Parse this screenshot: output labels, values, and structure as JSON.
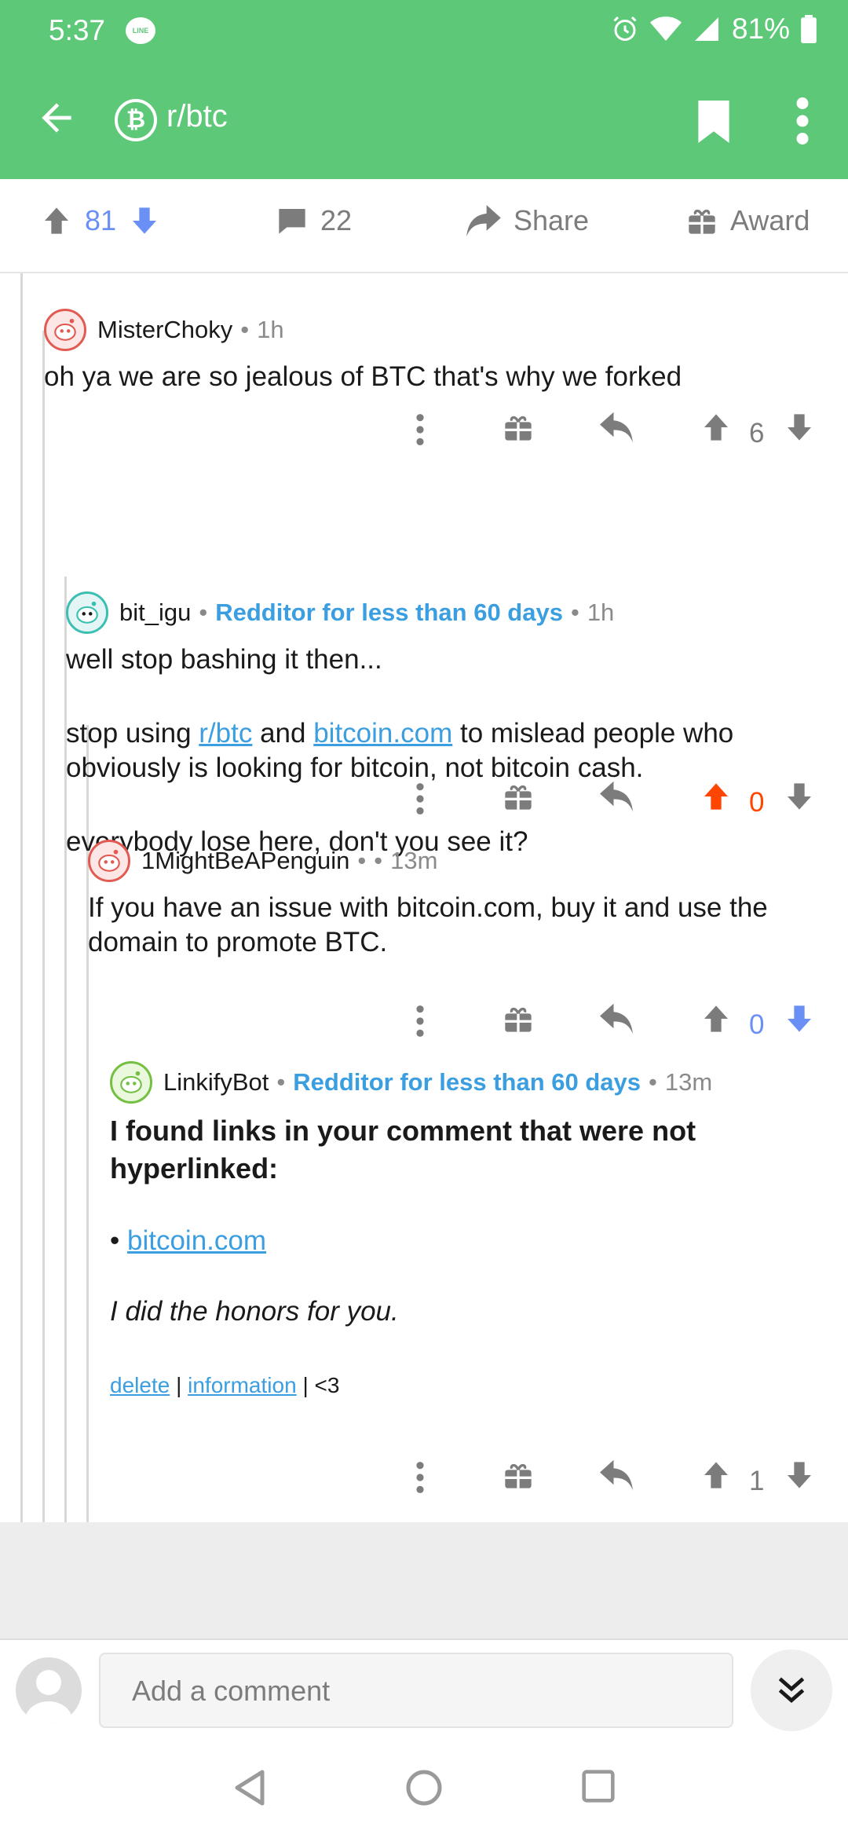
{
  "status_bar": {
    "time": "5:37",
    "line_badge": "LINE",
    "battery": "81%"
  },
  "app_bar": {
    "subreddit": "r/btc",
    "subreddit_icon": "bitcoin-icon",
    "brand_color": "#5ec879"
  },
  "post_actions": {
    "score": "81",
    "comments": "22",
    "share_label": "Share",
    "award_label": "Award"
  },
  "comments": [
    {
      "author": "MisterChoky",
      "sep": "•",
      "age": "1h",
      "body": "oh ya we are so jealous of BTC that's why we forked",
      "score": "6"
    },
    {
      "author": "bit_igu",
      "flair": "Redditor for less than 60 days",
      "sep": "•",
      "age": "1h",
      "p1": "well stop bashing it then...",
      "p2_a": "stop using ",
      "p2_link1": "r/btc",
      "p2_b": " and ",
      "p2_link2": "bitcoin.com",
      "p2_c": " to mislead people who obviously is looking for bitcoin, not bitcoin cash.",
      "p3": "everybody lose here, don't you see it?",
      "score": "0",
      "upvote_color": "#ff4500"
    },
    {
      "author": "1MightBeAPenguin",
      "sep": "•",
      "sep2": "•",
      "age": "13m",
      "body": "If you have an issue with bitcoin.com, buy it and use the domain to promote BTC.",
      "score": "0",
      "downvote_color": "#6a8ff5"
    },
    {
      "author": "LinkifyBot",
      "flair": "Redditor for less than 60 days",
      "sep": "•",
      "age": "13m",
      "title": "I found links in your comment that were not hyperlinked:",
      "bullet": "•",
      "link": "bitcoin.com",
      "italic": "I did the honors for you.",
      "footer_delete": "delete",
      "footer_pipe": "|",
      "footer_info": "information",
      "footer_heart": "| <3",
      "score": "1"
    }
  ],
  "composer": {
    "placeholder": "Add a comment"
  }
}
